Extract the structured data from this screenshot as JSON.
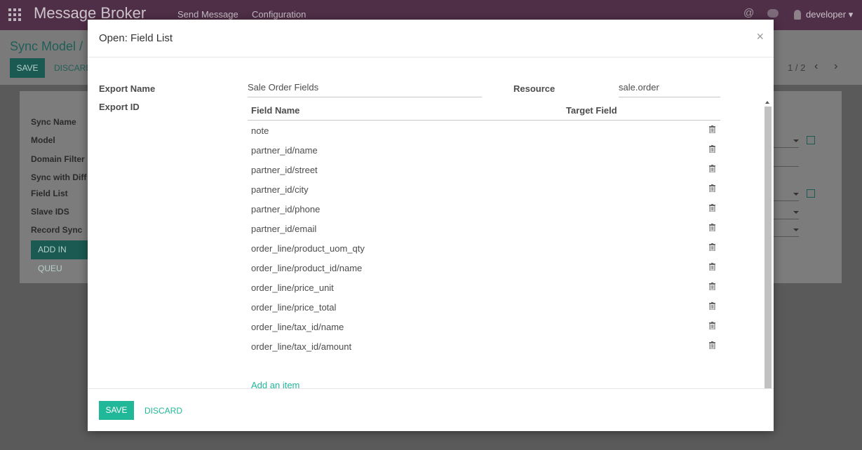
{
  "topbar": {
    "brand": "Message Broker",
    "menu": [
      "Send Message",
      "Configuration"
    ],
    "user": "developer",
    "at_icon": "at-icon",
    "chat_icon": "chat-icon"
  },
  "background": {
    "breadcrumb": "Sync Model /",
    "save_label": "SAVE",
    "discard_label": "DISCARD",
    "pager": "1 / 2",
    "labels": [
      "Sync Name",
      "Model",
      "Domain Filter",
      "Sync with Diff",
      "Field List",
      "Slave IDS",
      "Record Sync"
    ],
    "add_queue_label": "ADD IN QUEU"
  },
  "modal": {
    "title": "Open: Field List",
    "close": "×",
    "export_name_label": "Export Name",
    "export_name_value": "Sale Order Fields",
    "export_id_label": "Export ID",
    "resource_label": "Resource",
    "resource_value": "sale.order",
    "columns": [
      "Field Name",
      "Target Field"
    ],
    "rows": [
      "note",
      "partner_id/name",
      "partner_id/street",
      "partner_id/city",
      "partner_id/phone",
      "partner_id/email",
      "order_line/product_uom_qty",
      "order_line/product_id/name",
      "order_line/price_unit",
      "order_line/price_total",
      "order_line/tax_id/name",
      "order_line/tax_id/amount"
    ],
    "add_item": "Add an item",
    "save_label": "SAVE",
    "discard_label": "DISCARD"
  },
  "colors": {
    "accent": "#21b799",
    "topbar": "#4f2e47"
  }
}
